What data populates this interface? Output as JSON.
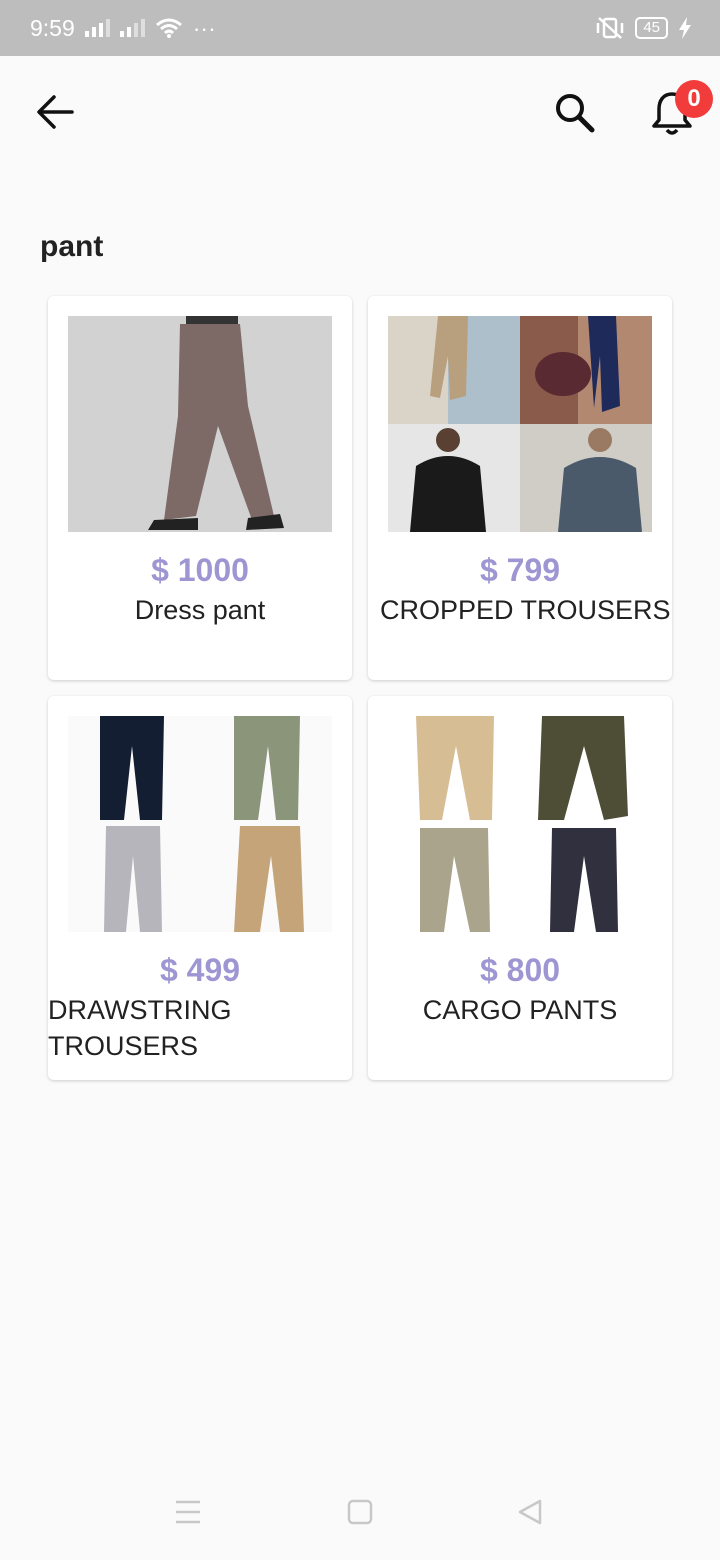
{
  "status_bar": {
    "time": "9:59",
    "more": "···",
    "battery": "45",
    "icons": [
      "signal-icon",
      "signal-icon",
      "wifi-icon",
      "vibrate-off-icon",
      "battery-icon",
      "charging-icon"
    ]
  },
  "app_bar": {
    "back_icon": "arrow-left-icon",
    "search_icon": "search-icon",
    "notification_icon": "bell-icon",
    "notification_count": "0",
    "badge_color": "#f23b3b"
  },
  "category": {
    "title": "pant"
  },
  "accent_color": "#9e96d2",
  "products": [
    {
      "price": "$ 1000",
      "name": "Dress pant"
    },
    {
      "price": "$ 799",
      "name": "CROPPED TROUSERS"
    },
    {
      "price": "$ 499",
      "name": "DRAWSTRING TROUSERS"
    },
    {
      "price": "$ 800",
      "name": "CARGO PANTS"
    }
  ],
  "nav_bar": {
    "icons": [
      "menu-icon",
      "home-square-icon",
      "back-triangle-icon"
    ]
  }
}
